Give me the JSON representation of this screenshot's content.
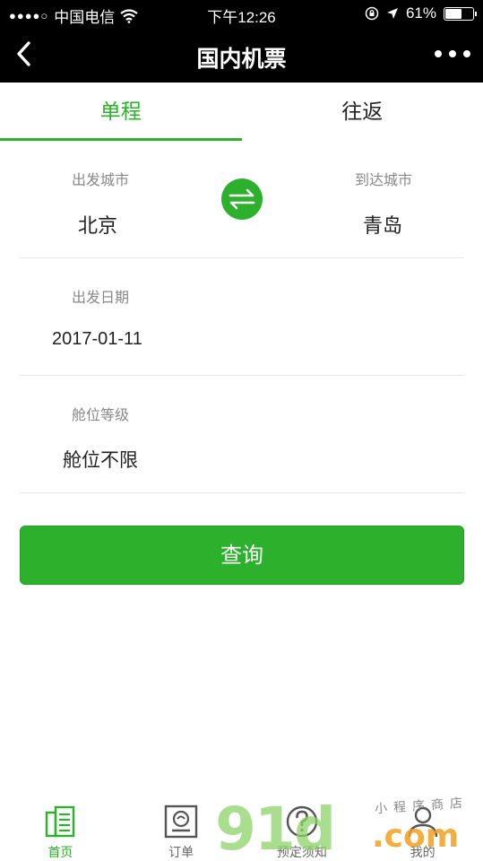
{
  "status_bar": {
    "signal": "●●●●○",
    "carrier": "中国电信",
    "time": "下午12:26",
    "battery_percent": "61%",
    "battery_level": 0.61
  },
  "nav": {
    "title": "国内机票",
    "back_icon": "chevron-left-icon",
    "more_icon": "more-dots-icon"
  },
  "tabs": [
    {
      "label": "单程",
      "active": true
    },
    {
      "label": "往返",
      "active": false
    }
  ],
  "form": {
    "depart_city_label": "出发城市",
    "depart_city": "北京",
    "arrive_city_label": "到达城市",
    "arrive_city": "青岛",
    "date_label": "出发日期",
    "date": "2017-01-11",
    "cabin_label": "舱位等级",
    "cabin": "舱位不限"
  },
  "search_button": "查询",
  "tabbar": [
    {
      "label": "首页",
      "icon": "home-icon",
      "active": true
    },
    {
      "label": "订单",
      "icon": "order-icon",
      "active": false
    },
    {
      "label": "预定须知",
      "icon": "question-icon",
      "active": false
    },
    {
      "label": "我的",
      "icon": "user-icon",
      "active": false
    }
  ],
  "watermark": {
    "big": "91d",
    "dotcom": ".com",
    "small": "小程序商店"
  },
  "colors": {
    "accent": "#2db12d",
    "bar": "#000000"
  }
}
